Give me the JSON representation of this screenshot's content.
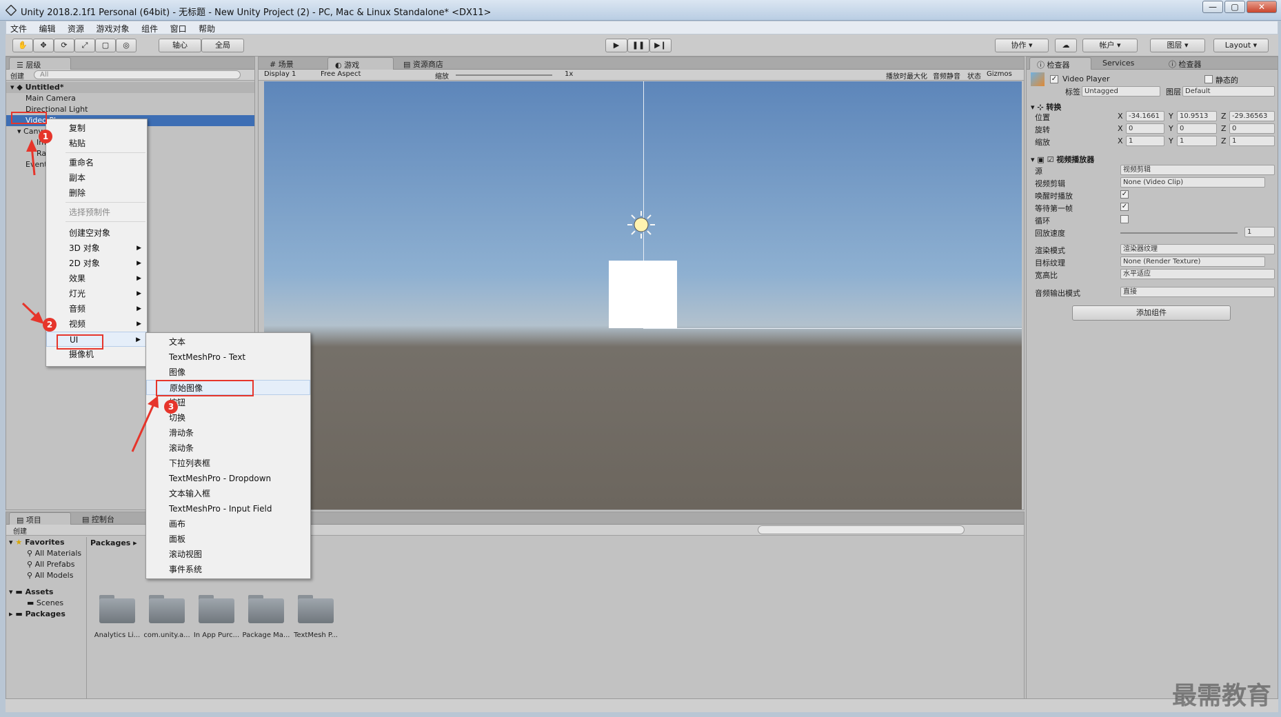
{
  "window": {
    "title": "Unity 2018.2.1f1 Personal (64bit) - 无标题 - New Unity Project (2) - PC, Mac & Linux Standalone* <DX11>",
    "min": "—",
    "max": "▢",
    "close": "✕"
  },
  "menubar": [
    "文件",
    "编辑",
    "资源",
    "游戏对象",
    "组件",
    "窗口",
    "帮助"
  ],
  "toolbar": {
    "pivot": "轴心",
    "global": "全局",
    "collab": "协作",
    "account": "帐户",
    "layers": "图层",
    "layout": "Layout"
  },
  "hierarchy": {
    "tab": "层级",
    "create": "创建",
    "search_placeholder": "All",
    "scene": "Untitled*",
    "items": [
      "Main Camera",
      "Directional Light",
      "Video Player",
      "Canv",
      "Im",
      "Ra",
      "Event"
    ]
  },
  "view_tabs": {
    "scene": "场景",
    "game": "游戏",
    "store": "资源商店",
    "display": "Display 1",
    "aspect": "Free Aspect",
    "scale_label": "缩放",
    "scale_value": "1x",
    "maximize": "播放时最大化",
    "mute": "音频静音",
    "stats": "状态",
    "gizmos": "Gizmos"
  },
  "context_menu": {
    "items": [
      {
        "label": "复制"
      },
      {
        "label": "粘贴"
      },
      {
        "label": "重命名"
      },
      {
        "label": "副本"
      },
      {
        "label": "删除"
      },
      {
        "label": "选择预制件"
      },
      {
        "label": "创建空对象"
      },
      {
        "label": "3D 对象"
      },
      {
        "label": "2D 对象"
      },
      {
        "label": "效果"
      },
      {
        "label": "灯光"
      },
      {
        "label": "音频"
      },
      {
        "label": "视频"
      },
      {
        "label": "UI"
      },
      {
        "label": "摄像机"
      }
    ]
  },
  "ui_submenu": {
    "items": [
      "文本",
      "TextMeshPro - Text",
      "图像",
      "原始图像",
      "按钮",
      "切换",
      "滑动条",
      "滚动条",
      "下拉列表框",
      "TextMeshPro - Dropdown",
      "文本输入框",
      "TextMeshPro - Input Field",
      "画布",
      "面板",
      "滚动视图",
      "事件系统"
    ]
  },
  "annotations": {
    "step1": "1",
    "step2": "2",
    "step3": "3"
  },
  "inspector": {
    "tab1": "检查器",
    "tab2": "Services",
    "tab3": "检查器",
    "object_name": "Video Player",
    "static": "静态的",
    "tag_label": "标签",
    "tag_value": "Untagged",
    "layer_label": "图层",
    "layer_value": "Default",
    "transform": {
      "title": "转换",
      "position_label": "位置",
      "pos_x": "-34.1661",
      "pos_y": "10.9513",
      "pos_z": "-29.36563",
      "rotation_label": "旋转",
      "rot_x": "0",
      "rot_y": "0",
      "rot_z": "0",
      "scale_label": "缩放",
      "scl_x": "1",
      "scl_y": "1",
      "scl_z": "1",
      "x": "X",
      "y": "Y",
      "z": "Z"
    },
    "video": {
      "title": "视频播放器",
      "source_label": "源",
      "source_value": "视频剪辑",
      "clip_label": "视频剪辑",
      "clip_value": "None (Video Clip)",
      "playonawake_label": "唤醒时播放",
      "waitfirst_label": "等待第一帧",
      "loop_label": "循环",
      "speed_label": "回放速度",
      "speed_value": "1",
      "render_label": "渲染模式",
      "render_value": "渲染器纹理",
      "target_label": "目标纹理",
      "target_value": "None (Render Texture)",
      "aspect_label": "宽高比",
      "aspect_value": "水平适应",
      "audio_label": "音频输出模式",
      "audio_value": "直接"
    },
    "add_component": "添加组件"
  },
  "project": {
    "tab1": "项目",
    "tab2": "控制台",
    "create": "创建",
    "favorites": "Favorites",
    "fav_items": [
      "All Materials",
      "All Prefabs",
      "All Models"
    ],
    "assets": "Assets",
    "scenes": "Scenes",
    "packages": "Packages",
    "breadcrumb": "Packages",
    "folders": [
      "Analytics Li...",
      "com.unity.a...",
      "In App Purc...",
      "Package Ma...",
      "TextMesh P..."
    ]
  },
  "watermark": "最需教育"
}
